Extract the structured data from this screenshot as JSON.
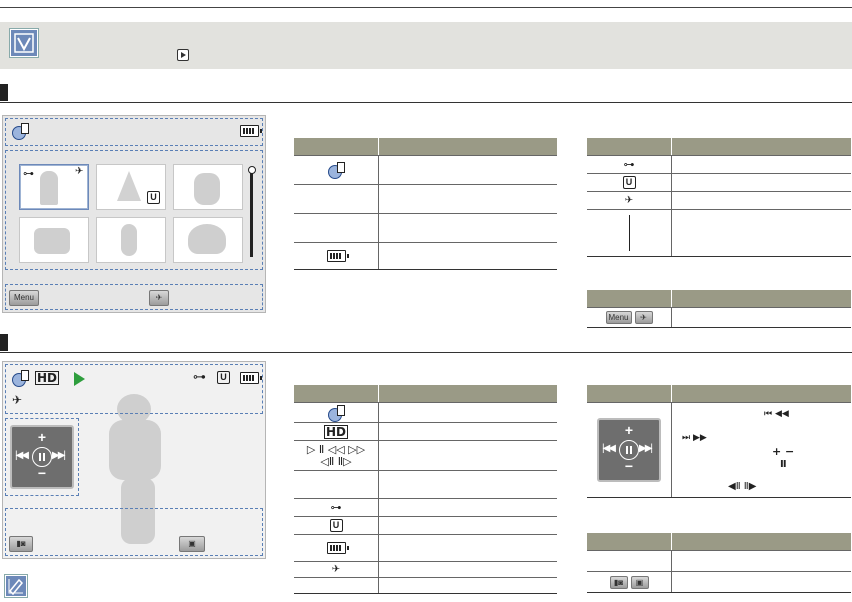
{
  "icons": {
    "note_check": "checkbox-note-icon",
    "play_mode": "play-mode-icon",
    "video_mode": "video-play-mode-icon",
    "hd": "HD",
    "protect": "protect-key-icon",
    "unlock": "u-icon",
    "share": "share-mark-icon",
    "battery": "battery-icon",
    "menu_button": "Menu"
  },
  "playback": {
    "symbols_row1": "▷ Ⅱ ◁◁ ▷▷",
    "symbols_row2": "◁Ⅱ Ⅱ▷"
  },
  "colors": {
    "header_gray": "#9a9a86",
    "note_bar": "#e2e2de",
    "accent_blue": "#6d89b9",
    "play_green": "#2e9e3d"
  }
}
